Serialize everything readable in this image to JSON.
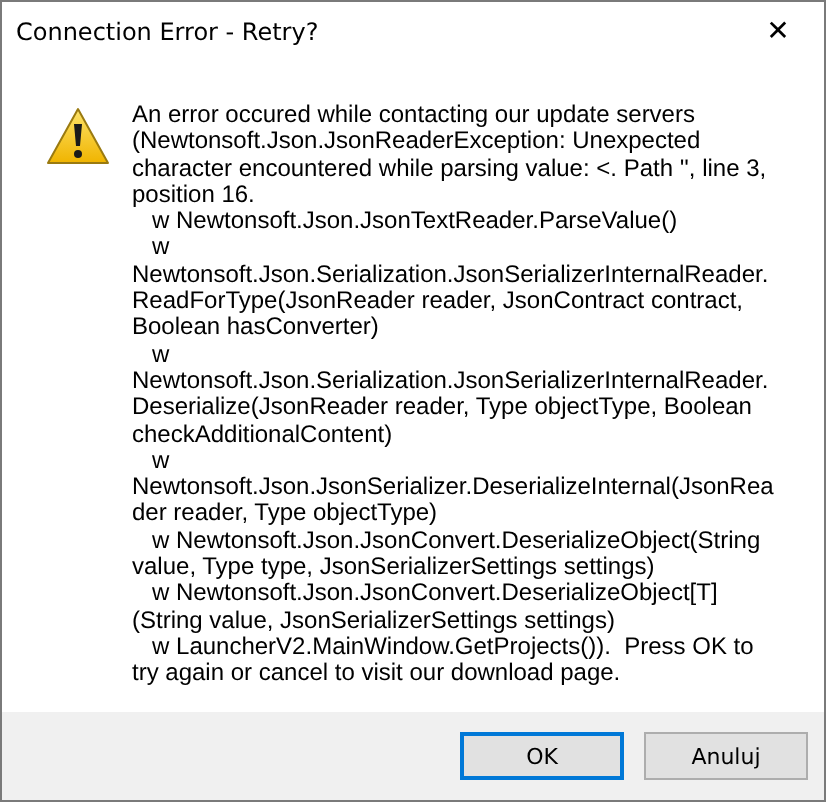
{
  "window": {
    "title": "Connection Error - Retry?",
    "close": "✕"
  },
  "message": "An error occured while contacting our update servers (Newtonsoft.Json.JsonReaderException: Unexpected character encountered while parsing value: <. Path '', line 3, position 16.\n   w Newtonsoft.Json.JsonTextReader.ParseValue()\n   w Newtonsoft.Json.Serialization.JsonSerializerInternalReader.ReadForType(JsonReader reader, JsonContract contract, Boolean hasConverter)\n   w Newtonsoft.Json.Serialization.JsonSerializerInternalReader.Deserialize(JsonReader reader, Type objectType, Boolean checkAdditionalContent)\n   w Newtonsoft.Json.JsonSerializer.DeserializeInternal(JsonReader reader, Type objectType)\n   w Newtonsoft.Json.JsonConvert.DeserializeObject(String value, Type type, JsonSerializerSettings settings)\n   w Newtonsoft.Json.JsonConvert.DeserializeObject[T](String value, JsonSerializerSettings settings)\n   w LauncherV2.MainWindow.GetProjects()).  Press OK to try again or cancel to visit our download page.",
  "buttons": [
    {
      "label": "OK",
      "default": true
    },
    {
      "label": "Anuluj",
      "default": false
    }
  ]
}
